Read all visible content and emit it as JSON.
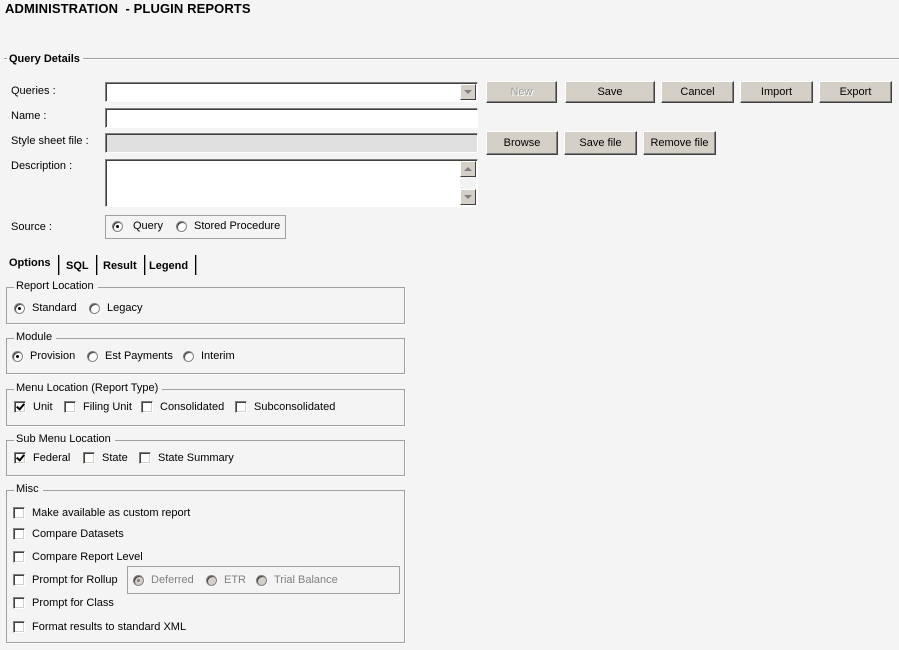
{
  "header": {
    "title": "ADMINISTRATION  - PLUGIN REPORTS"
  },
  "query_details": {
    "section_title": "Query Details",
    "queries": {
      "label": "Queries :",
      "value": ""
    },
    "name": {
      "label": "Name :",
      "value": ""
    },
    "style_sheet": {
      "label": "Style sheet file :",
      "value": ""
    },
    "description": {
      "label": "Description :",
      "value": ""
    },
    "source": {
      "label": "Source :",
      "options": [
        {
          "label": "Query",
          "checked": true
        },
        {
          "label": "Stored Procedure",
          "checked": false
        }
      ]
    },
    "buttons": {
      "new": "New",
      "save": "Save",
      "cancel": "Cancel",
      "import": "Import",
      "export": "Export",
      "browse": "Browse",
      "save_file": "Save file",
      "remove_file": "Remove file"
    }
  },
  "tabs": [
    {
      "label": "Options",
      "active": true
    },
    {
      "label": "SQL",
      "active": false
    },
    {
      "label": "Result",
      "active": false
    },
    {
      "label": "Legend",
      "active": false
    }
  ],
  "options": {
    "report_location": {
      "title": "Report Location",
      "options": [
        {
          "label": "Standard",
          "checked": true
        },
        {
          "label": "Legacy",
          "checked": false
        }
      ]
    },
    "module": {
      "title": "Module",
      "options": [
        {
          "label": "Provision",
          "checked": true
        },
        {
          "label": "Est Payments",
          "checked": false
        },
        {
          "label": "Interim",
          "checked": false
        }
      ]
    },
    "menu_location": {
      "title": "Menu Location (Report Type)",
      "options": [
        {
          "label": "Unit",
          "checked": true
        },
        {
          "label": "Filing Unit",
          "checked": false
        },
        {
          "label": "Consolidated",
          "checked": false
        },
        {
          "label": "Subconsolidated",
          "checked": false
        }
      ]
    },
    "sub_menu_location": {
      "title": "Sub Menu Location",
      "options": [
        {
          "label": "Federal",
          "checked": true
        },
        {
          "label": "State",
          "checked": false
        },
        {
          "label": "State Summary",
          "checked": false
        }
      ]
    },
    "misc": {
      "title": "Misc",
      "options": [
        {
          "label": "Make available as custom report",
          "checked": false
        },
        {
          "label": "Compare Datasets",
          "checked": false
        },
        {
          "label": "Compare Report Level",
          "checked": false
        },
        {
          "label": "Prompt for Rollup",
          "checked": false
        },
        {
          "label": "Prompt for Class",
          "checked": false
        },
        {
          "label": "Format results to standard XML",
          "checked": false
        }
      ],
      "rollup_options": [
        {
          "label": "Deferred",
          "checked": true,
          "disabled": true
        },
        {
          "label": "ETR",
          "checked": false,
          "disabled": true
        },
        {
          "label": "Trial Balance",
          "checked": false,
          "disabled": true
        }
      ]
    }
  }
}
